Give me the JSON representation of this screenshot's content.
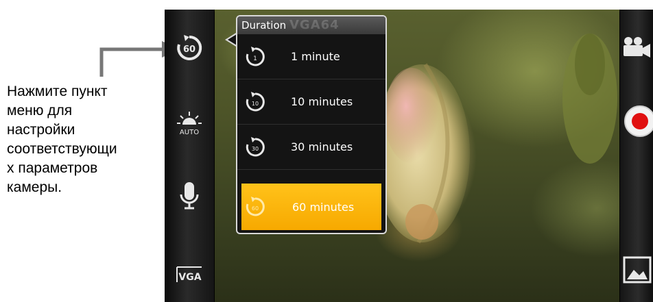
{
  "caption": {
    "text": "Нажмите пункт\nменю для\nнастройки\nсоответствующи\nх параметров\nкамеры."
  },
  "popup": {
    "title": "Duration",
    "ghost_text": "VGA64",
    "options": [
      {
        "label": "1 minute",
        "icon": "timer-1-icon",
        "icon_text": "1",
        "selected": false
      },
      {
        "label": "10 minutes",
        "icon": "timer-10-icon",
        "icon_text": "10",
        "selected": false
      },
      {
        "label": "30 minutes",
        "icon": "timer-30-icon",
        "icon_text": "30",
        "selected": false
      },
      {
        "label": "60 minutes",
        "icon": "timer-60-icon",
        "icon_text": "60",
        "selected": true
      }
    ]
  },
  "leftbar": {
    "items": [
      {
        "name": "duration-setting",
        "icon": "timer-60-icon",
        "text": "60"
      },
      {
        "name": "white-balance-setting",
        "icon": "sun-auto-icon",
        "text": "AUTO"
      },
      {
        "name": "microphone-setting",
        "icon": "microphone-icon"
      },
      {
        "name": "video-quality-setting",
        "icon": "vga-icon",
        "text": "VGA"
      }
    ]
  },
  "rightbar": {
    "items": [
      {
        "name": "camera-mode-switch",
        "icon": "video-camera-icon"
      },
      {
        "name": "record-button",
        "icon": "record-icon"
      },
      {
        "name": "gallery-button",
        "icon": "gallery-icon"
      }
    ]
  },
  "colors": {
    "selected": "#f7a900",
    "record": "#e01010",
    "popup_bg": "#141414"
  }
}
